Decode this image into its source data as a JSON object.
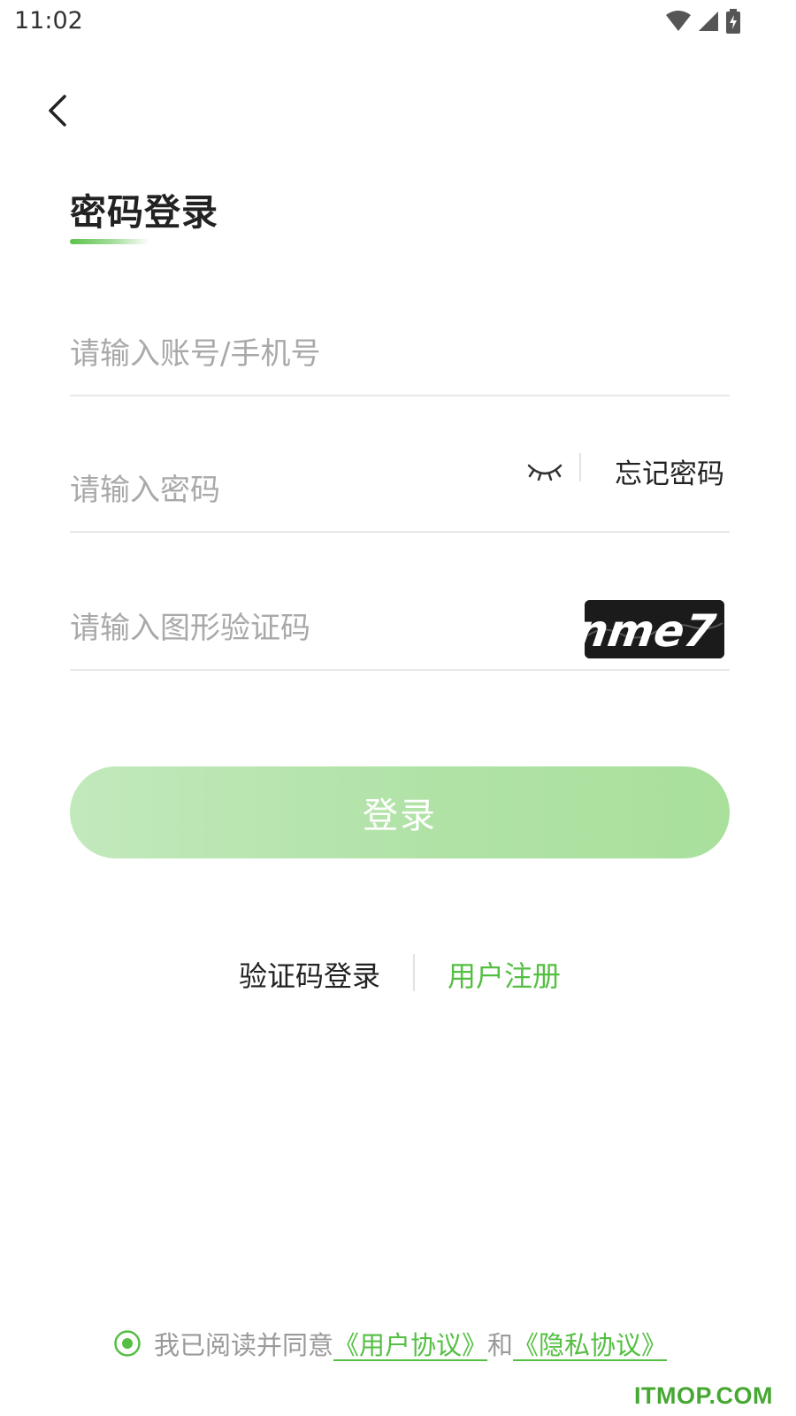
{
  "status_bar": {
    "time": "11:02",
    "icons": [
      "wifi-icon",
      "signal-icon",
      "battery-charging-icon"
    ]
  },
  "header": {
    "back_icon": "chevron-left-icon"
  },
  "title": "密码登录",
  "form": {
    "account_placeholder": "请输入账号/手机号",
    "password_placeholder": "请输入密码",
    "password_toggle_icon": "eye-closed-icon",
    "forgot_password": "忘记密码",
    "captcha_placeholder": "请输入图形验证码",
    "captcha_text": "nme7"
  },
  "login_button": "登录",
  "alt_links": {
    "sms_login": "验证码登录",
    "register": "用户注册"
  },
  "agreement": {
    "prefix": "我已阅读并同意",
    "user_agreement": "《用户协议》",
    "conjunction": "和",
    "privacy_agreement": "《隐私协议》"
  },
  "watermark": "ITMOP.COM",
  "colors": {
    "accent": "#54bf42",
    "button_gradient_start": "#c2e9bc",
    "button_gradient_end": "#a9e09c",
    "placeholder": "#a9a9a9",
    "divider": "#e8e8e8"
  }
}
